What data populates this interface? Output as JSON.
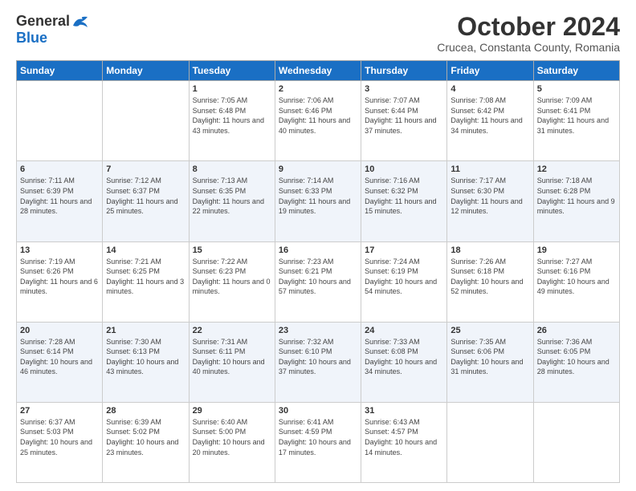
{
  "logo": {
    "general": "General",
    "blue": "Blue"
  },
  "header": {
    "month": "October 2024",
    "location": "Crucea, Constanta County, Romania"
  },
  "weekdays": [
    "Sunday",
    "Monday",
    "Tuesday",
    "Wednesday",
    "Thursday",
    "Friday",
    "Saturday"
  ],
  "weeks": [
    [
      {
        "day": "",
        "info": ""
      },
      {
        "day": "",
        "info": ""
      },
      {
        "day": "1",
        "info": "Sunrise: 7:05 AM\nSunset: 6:48 PM\nDaylight: 11 hours and 43 minutes."
      },
      {
        "day": "2",
        "info": "Sunrise: 7:06 AM\nSunset: 6:46 PM\nDaylight: 11 hours and 40 minutes."
      },
      {
        "day": "3",
        "info": "Sunrise: 7:07 AM\nSunset: 6:44 PM\nDaylight: 11 hours and 37 minutes."
      },
      {
        "day": "4",
        "info": "Sunrise: 7:08 AM\nSunset: 6:42 PM\nDaylight: 11 hours and 34 minutes."
      },
      {
        "day": "5",
        "info": "Sunrise: 7:09 AM\nSunset: 6:41 PM\nDaylight: 11 hours and 31 minutes."
      }
    ],
    [
      {
        "day": "6",
        "info": "Sunrise: 7:11 AM\nSunset: 6:39 PM\nDaylight: 11 hours and 28 minutes."
      },
      {
        "day": "7",
        "info": "Sunrise: 7:12 AM\nSunset: 6:37 PM\nDaylight: 11 hours and 25 minutes."
      },
      {
        "day": "8",
        "info": "Sunrise: 7:13 AM\nSunset: 6:35 PM\nDaylight: 11 hours and 22 minutes."
      },
      {
        "day": "9",
        "info": "Sunrise: 7:14 AM\nSunset: 6:33 PM\nDaylight: 11 hours and 19 minutes."
      },
      {
        "day": "10",
        "info": "Sunrise: 7:16 AM\nSunset: 6:32 PM\nDaylight: 11 hours and 15 minutes."
      },
      {
        "day": "11",
        "info": "Sunrise: 7:17 AM\nSunset: 6:30 PM\nDaylight: 11 hours and 12 minutes."
      },
      {
        "day": "12",
        "info": "Sunrise: 7:18 AM\nSunset: 6:28 PM\nDaylight: 11 hours and 9 minutes."
      }
    ],
    [
      {
        "day": "13",
        "info": "Sunrise: 7:19 AM\nSunset: 6:26 PM\nDaylight: 11 hours and 6 minutes."
      },
      {
        "day": "14",
        "info": "Sunrise: 7:21 AM\nSunset: 6:25 PM\nDaylight: 11 hours and 3 minutes."
      },
      {
        "day": "15",
        "info": "Sunrise: 7:22 AM\nSunset: 6:23 PM\nDaylight: 11 hours and 0 minutes."
      },
      {
        "day": "16",
        "info": "Sunrise: 7:23 AM\nSunset: 6:21 PM\nDaylight: 10 hours and 57 minutes."
      },
      {
        "day": "17",
        "info": "Sunrise: 7:24 AM\nSunset: 6:19 PM\nDaylight: 10 hours and 54 minutes."
      },
      {
        "day": "18",
        "info": "Sunrise: 7:26 AM\nSunset: 6:18 PM\nDaylight: 10 hours and 52 minutes."
      },
      {
        "day": "19",
        "info": "Sunrise: 7:27 AM\nSunset: 6:16 PM\nDaylight: 10 hours and 49 minutes."
      }
    ],
    [
      {
        "day": "20",
        "info": "Sunrise: 7:28 AM\nSunset: 6:14 PM\nDaylight: 10 hours and 46 minutes."
      },
      {
        "day": "21",
        "info": "Sunrise: 7:30 AM\nSunset: 6:13 PM\nDaylight: 10 hours and 43 minutes."
      },
      {
        "day": "22",
        "info": "Sunrise: 7:31 AM\nSunset: 6:11 PM\nDaylight: 10 hours and 40 minutes."
      },
      {
        "day": "23",
        "info": "Sunrise: 7:32 AM\nSunset: 6:10 PM\nDaylight: 10 hours and 37 minutes."
      },
      {
        "day": "24",
        "info": "Sunrise: 7:33 AM\nSunset: 6:08 PM\nDaylight: 10 hours and 34 minutes."
      },
      {
        "day": "25",
        "info": "Sunrise: 7:35 AM\nSunset: 6:06 PM\nDaylight: 10 hours and 31 minutes."
      },
      {
        "day": "26",
        "info": "Sunrise: 7:36 AM\nSunset: 6:05 PM\nDaylight: 10 hours and 28 minutes."
      }
    ],
    [
      {
        "day": "27",
        "info": "Sunrise: 6:37 AM\nSunset: 5:03 PM\nDaylight: 10 hours and 25 minutes."
      },
      {
        "day": "28",
        "info": "Sunrise: 6:39 AM\nSunset: 5:02 PM\nDaylight: 10 hours and 23 minutes."
      },
      {
        "day": "29",
        "info": "Sunrise: 6:40 AM\nSunset: 5:00 PM\nDaylight: 10 hours and 20 minutes."
      },
      {
        "day": "30",
        "info": "Sunrise: 6:41 AM\nSunset: 4:59 PM\nDaylight: 10 hours and 17 minutes."
      },
      {
        "day": "31",
        "info": "Sunrise: 6:43 AM\nSunset: 4:57 PM\nDaylight: 10 hours and 14 minutes."
      },
      {
        "day": "",
        "info": ""
      },
      {
        "day": "",
        "info": ""
      }
    ]
  ]
}
